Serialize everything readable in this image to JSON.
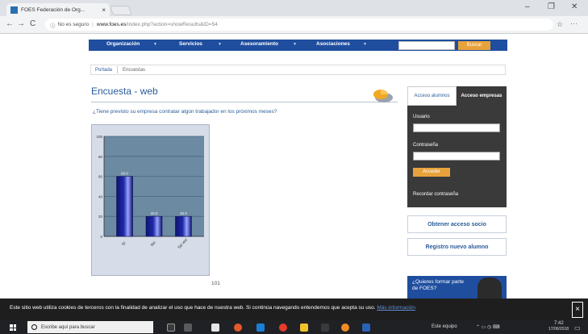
{
  "browser": {
    "tab_title": "FOES Federación de Org...",
    "tab_close": "×",
    "back": "←",
    "forward": "→",
    "reload": "C",
    "security": "No es seguro",
    "url_main": "www.foes.es",
    "url_rest": "/index.php?action=showResults&ID=54",
    "minimize": "–",
    "maximize": "❐",
    "close": "✕",
    "star": "☆",
    "menu": "⋯"
  },
  "nav": {
    "items": [
      "Organización",
      "Servicios",
      "Asesoramiento",
      "Asociaciones"
    ],
    "search_button": "Buscar"
  },
  "breadcrumb": {
    "home": "Portada",
    "current": "Encuestas"
  },
  "main": {
    "title": "Encuesta - web",
    "question": "¿Tiene previsto su empresa contratar algún trabajador en los próximos meses?",
    "page_number": "101"
  },
  "chart_data": {
    "type": "bar",
    "categories": [
      "Sí",
      "No",
      "Tal vez"
    ],
    "values": [
      60.0,
      20.0,
      20.0
    ],
    "data_labels": [
      "60.0",
      "20.0",
      "20.0"
    ],
    "ylim": [
      0,
      100
    ],
    "yticks": [
      0,
      20,
      40,
      60,
      80,
      100
    ],
    "grid": true,
    "bar_color": "#1f2aa8",
    "plot_bg": "#6d8aa3"
  },
  "sidebar": {
    "tab_alumnos": "Acceso alumnos",
    "tab_empresas": "Acceso empresas",
    "user_label": "Usuario",
    "password_label": "Contraseña",
    "login_button": "Acceder",
    "forgot": "Recordar contraseña",
    "btn_partner": "Obtener acceso socio",
    "btn_register": "Registro nuevo alumno",
    "promo": "¿Quieres formar parte de FOES?"
  },
  "cookie": {
    "text": "Este sitio web utiliza cookies de terceros con la finalidad de analizar el uso que hace de nuestra web. Si continúa navegando entendemos que acepta su uso.",
    "more": "Más información",
    "close": "×"
  },
  "taskbar": {
    "search_placeholder": "Escribe aquí para buscar",
    "network": "Este equipo",
    "time": "7:42",
    "date": "17/06/2018"
  }
}
